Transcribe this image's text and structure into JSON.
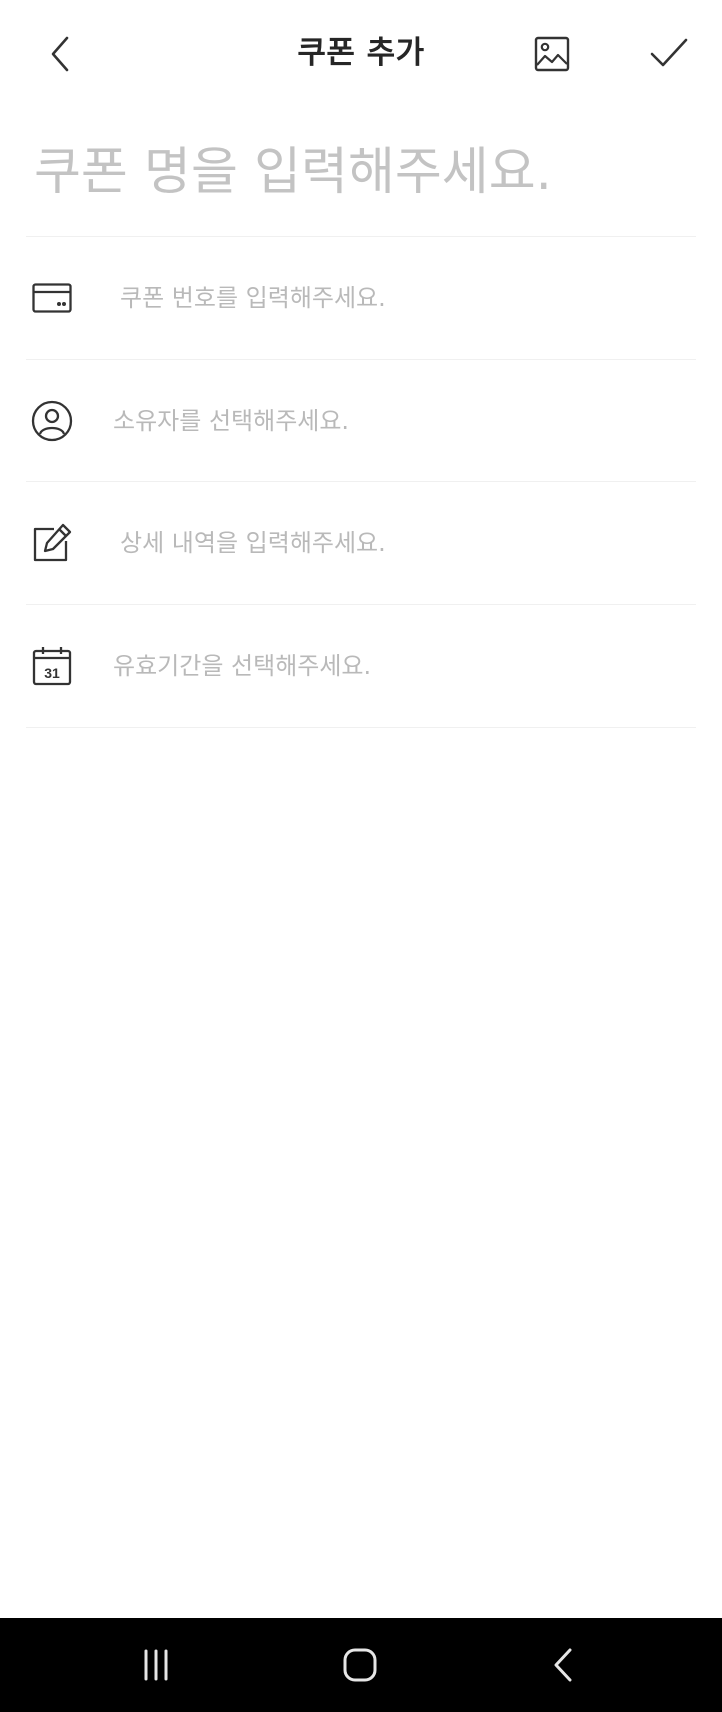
{
  "app_bar": {
    "title": "쿠폰 추가",
    "back_icon": "chevron-left-icon",
    "image_icon": "image-icon",
    "done_icon": "checkmark-icon"
  },
  "coupon_name": {
    "placeholder": "쿠폰 명을 입력해주세요.",
    "value": ""
  },
  "fields": [
    {
      "icon": "card-icon",
      "placeholder": "쿠폰 번호를 입력해주세요."
    },
    {
      "icon": "user-icon",
      "placeholder": "소유자를 선택해주세요."
    },
    {
      "icon": "edit-icon",
      "placeholder": "상세 내역을 입력해주세요."
    },
    {
      "icon": "calendar-icon",
      "placeholder": "유효기간을 선택해주세요.",
      "calendar_day": "31"
    }
  ],
  "system_nav": {
    "recents_icon": "recents-icon",
    "home_icon": "home-icon",
    "back_icon": "back-icon"
  },
  "colors": {
    "title": "#262626",
    "icon": "#333333",
    "placeholder": "#b9b9b9",
    "name_placeholder": "#c3c3c3",
    "divider": "#f0f0f0",
    "nav_bar": "#000000"
  }
}
